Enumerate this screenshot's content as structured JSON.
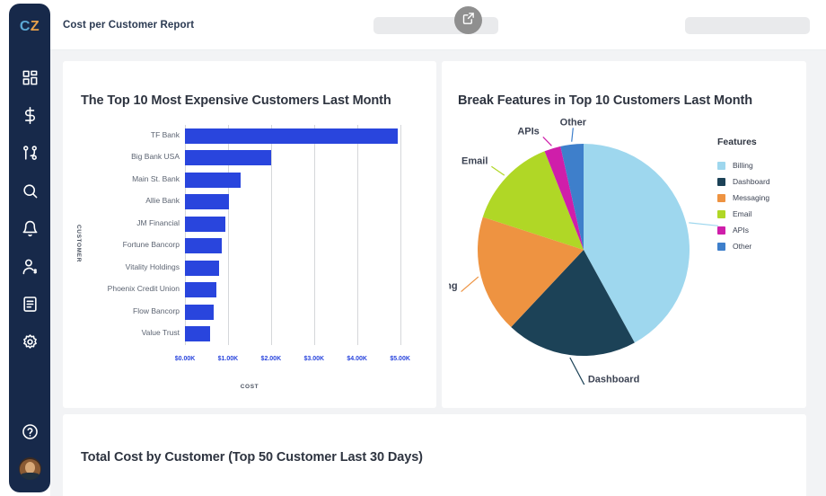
{
  "sidebar": {
    "logo": {
      "first": "C",
      "second": "Z"
    },
    "items": [
      {
        "name": "dashboard",
        "icon": "grid-icon",
        "active": false
      },
      {
        "name": "billing",
        "icon": "dollar-icon",
        "active": false
      },
      {
        "name": "workflows",
        "icon": "branch-icon",
        "active": false
      },
      {
        "name": "search",
        "icon": "search-icon",
        "active": false
      },
      {
        "name": "notifications",
        "icon": "bell-icon",
        "active": false
      },
      {
        "name": "customers",
        "icon": "user-icon",
        "active": true
      },
      {
        "name": "reports",
        "icon": "document-icon",
        "active": false
      },
      {
        "name": "settings",
        "icon": "gear-icon",
        "active": false
      }
    ],
    "help": {
      "name": "help",
      "icon": "help-circle-icon"
    },
    "avatar": {
      "name": "avatar"
    }
  },
  "header": {
    "title": "Cost per Customer Report",
    "cursor_icon": "external-link-icon"
  },
  "cards": {
    "bar": {
      "title": "The Top 10 Most Expensive Customers Last Month"
    },
    "pie": {
      "title": "Break Features in Top 10 Customers Last Month"
    },
    "bottom": {
      "title": "Total Cost by Customer (Top 50 Customer Last 30 Days)"
    }
  },
  "legend": {
    "title": "Features"
  },
  "colors": {
    "bar": "#2945DD",
    "sidebar": "#17294a",
    "canvas": "#f2f3f5",
    "logo_c": "#5BA8D4",
    "logo_z": "#E7A04A"
  },
  "chart_data": [
    {
      "type": "bar",
      "title": "The Top 10 Most Expensive Customers Last Month",
      "orientation": "horizontal",
      "xlabel": "COST",
      "ylabel": "CUSTOMER",
      "categories": [
        "TF Bank",
        "Big Bank USA",
        "Main St. Bank",
        "Allie Bank",
        "JM Financial",
        "Fortune Bancorp",
        "Vitality Holdings",
        "Phoenix Credit Union",
        "Flow Bancorp",
        "Value Trust"
      ],
      "values": [
        4950,
        2005,
        1290,
        1020,
        930,
        850,
        790,
        730,
        660,
        590
      ],
      "xticks": [
        "$0.00K",
        "$1.00K",
        "$2.00K",
        "$3.00K",
        "$4.00K",
        "$5.00K"
      ],
      "xtick_values": [
        0,
        1000,
        2000,
        3000,
        4000,
        5000
      ],
      "xlim": [
        0,
        5300
      ],
      "grid": true,
      "series_color": "#2945DD"
    },
    {
      "type": "pie",
      "title": "Break Features in Top 10 Customers Last Month",
      "legend_title": "Features",
      "legend_position": "right",
      "labels": [
        "Billing",
        "Dashboard",
        "Messaging",
        "Email",
        "APIs",
        "Other"
      ],
      "values": [
        42,
        20,
        18,
        14,
        2.5,
        3.5
      ],
      "colors": [
        "#9ED7EE",
        "#1C4257",
        "#EE9341",
        "#B0D726",
        "#CF1EAA",
        "#3E7FCB"
      ],
      "start_angle_deg": 0,
      "direction": "clockwise"
    }
  ]
}
